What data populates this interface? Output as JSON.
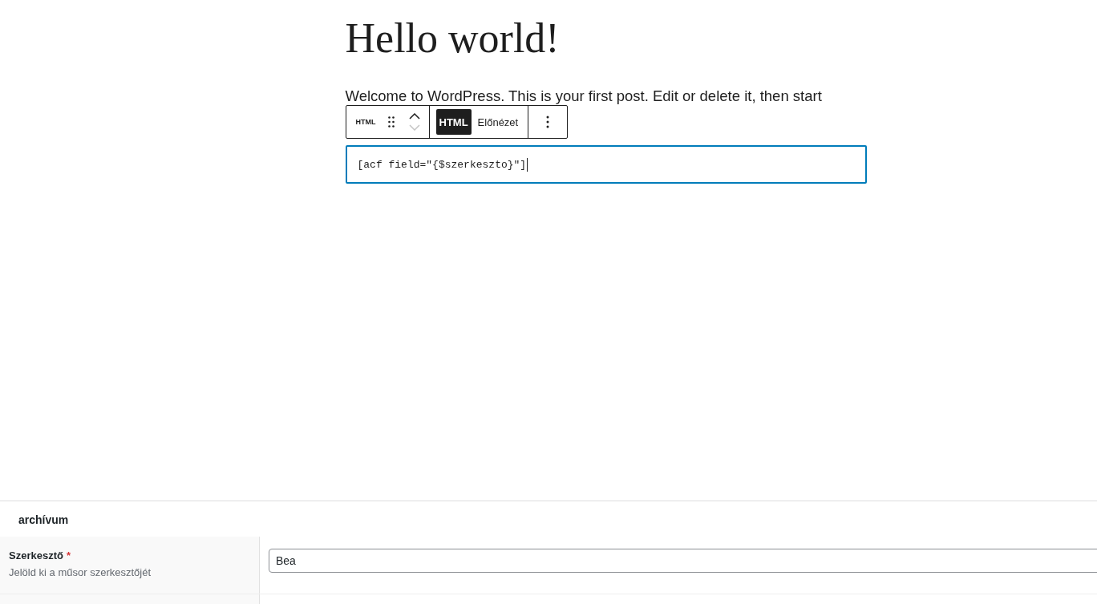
{
  "post": {
    "title": "Hello world!",
    "paragraph": "Welcome to WordPress. This is your first post. Edit or delete it, then start"
  },
  "block_toolbar": {
    "block_type": "HTML",
    "mover": {
      "up_disabled": false,
      "down_disabled": true
    },
    "tabs": [
      {
        "label": "HTML",
        "selected": true
      },
      {
        "label": "Előnézet",
        "selected": false
      }
    ]
  },
  "html_block": {
    "value": "[acf field=\"{$szerkeszto}\"]",
    "focused": true
  },
  "meta_box": {
    "title": "archívum",
    "fields": [
      {
        "label": "Szerkesztő",
        "required_mark": "*",
        "description": "Jelöld ki a műsor szerkesztőjét",
        "value": "Bea"
      }
    ]
  }
}
